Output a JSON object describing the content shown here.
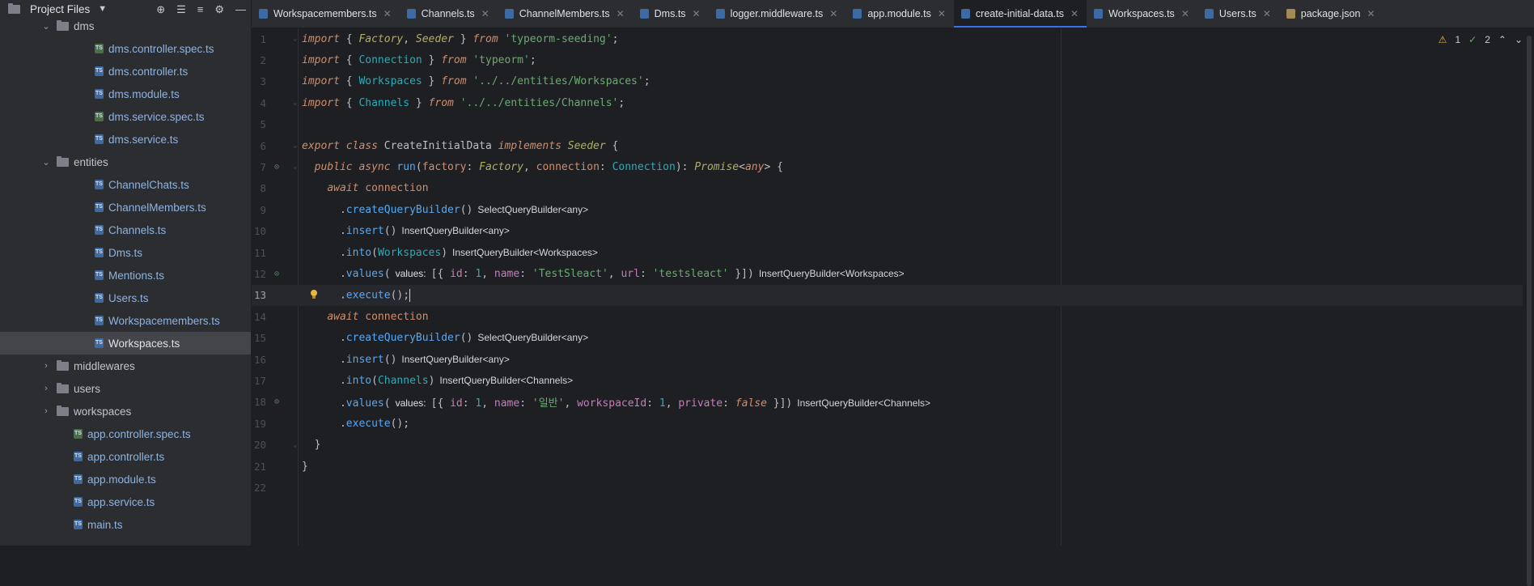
{
  "project": {
    "title": "Project Files",
    "tree": [
      {
        "label": "dms",
        "kind": "folder",
        "depth": 1,
        "expanded": true
      },
      {
        "label": "dms.controller.spec.ts",
        "kind": "file",
        "depth": 2,
        "spec": true
      },
      {
        "label": "dms.controller.ts",
        "kind": "file",
        "depth": 2
      },
      {
        "label": "dms.module.ts",
        "kind": "file",
        "depth": 2
      },
      {
        "label": "dms.service.spec.ts",
        "kind": "file",
        "depth": 2,
        "spec": true
      },
      {
        "label": "dms.service.ts",
        "kind": "file",
        "depth": 2
      },
      {
        "label": "entities",
        "kind": "folder",
        "depth": 1,
        "expanded": true
      },
      {
        "label": "ChannelChats.ts",
        "kind": "file",
        "depth": 2
      },
      {
        "label": "ChannelMembers.ts",
        "kind": "file",
        "depth": 2
      },
      {
        "label": "Channels.ts",
        "kind": "file",
        "depth": 2
      },
      {
        "label": "Dms.ts",
        "kind": "file",
        "depth": 2
      },
      {
        "label": "Mentions.ts",
        "kind": "file",
        "depth": 2
      },
      {
        "label": "Users.ts",
        "kind": "file",
        "depth": 2
      },
      {
        "label": "Workspacemembers.ts",
        "kind": "file",
        "depth": 2
      },
      {
        "label": "Workspaces.ts",
        "kind": "file",
        "depth": 2,
        "selected": true
      },
      {
        "label": "middlewares",
        "kind": "folder",
        "depth": 1,
        "expanded": false
      },
      {
        "label": "users",
        "kind": "folder",
        "depth": 1,
        "expanded": false
      },
      {
        "label": "workspaces",
        "kind": "folder",
        "depth": 1,
        "expanded": false
      },
      {
        "label": "app.controller.spec.ts",
        "kind": "file",
        "depth": 1,
        "spec": true
      },
      {
        "label": "app.controller.ts",
        "kind": "file",
        "depth": 1
      },
      {
        "label": "app.module.ts",
        "kind": "file",
        "depth": 1
      },
      {
        "label": "app.service.ts",
        "kind": "file",
        "depth": 1
      },
      {
        "label": "main.ts",
        "kind": "file",
        "depth": 1
      }
    ]
  },
  "tabs": [
    {
      "label": "Workspacemembers.ts"
    },
    {
      "label": "Channels.ts"
    },
    {
      "label": "ChannelMembers.ts"
    },
    {
      "label": "Dms.ts"
    },
    {
      "label": "logger.middleware.ts"
    },
    {
      "label": "app.module.ts"
    },
    {
      "label": "create-initial-data.ts",
      "active": true
    },
    {
      "label": "Workspaces.ts"
    },
    {
      "label": "Users.ts"
    },
    {
      "label": "package.json",
      "json": true
    }
  ],
  "inspections": {
    "warnings": "1",
    "weak_warnings": "2"
  },
  "editor": {
    "current_line": 13,
    "lines": [
      {
        "n": "1",
        "fold": true,
        "html": "<span class=\"kw\">import</span> { <span class=\"itype\">Factory</span>, <span class=\"itype\">Seeder</span> } <span class=\"kw\">from</span> <span class=\"str\">'typeorm-seeding'</span>;"
      },
      {
        "n": "2",
        "html": "<span class=\"kw\">import</span> { <span class=\"type\">Connection</span> } <span class=\"kw\">from</span> <span class=\"str\">'typeorm'</span>;"
      },
      {
        "n": "3",
        "html": "<span class=\"kw\">import</span> { <span class=\"type\">Workspaces</span> } <span class=\"kw\">from</span> <span class=\"str\">'../../entities/Workspaces'</span>;"
      },
      {
        "n": "4",
        "fold": true,
        "html": "<span class=\"kw\">import</span> { <span class=\"type\">Channels</span> } <span class=\"kw\">from</span> <span class=\"str\">'../../entities/Channels'</span>;"
      },
      {
        "n": "5",
        "html": ""
      },
      {
        "n": "6",
        "fold": true,
        "html": "<span class=\"kw\">export class</span> <span class=\"cls\">CreateInitialData</span> <span class=\"kw\">implements</span> <span class=\"itype\">Seeder</span> {"
      },
      {
        "n": "7",
        "mark": true,
        "fold": true,
        "html": "  <span class=\"kw\">public async</span> <span class=\"fn\">run</span>(<span class=\"kw2\">factory</span>: <span class=\"itype\">Factory</span>, <span class=\"kw2\">connection</span>: <span class=\"type\">Connection</span>): <span class=\"itype\">Promise</span>&lt;<span class=\"kw\">any</span>&gt; {"
      },
      {
        "n": "8",
        "html": "    <span class=\"kw\">await</span> <span class=\"kw2\">connection</span>"
      },
      {
        "n": "9",
        "html": "      .<span class=\"fn\">createQueryBuilder</span>()<span class=\"hint\">SelectQueryBuilder&lt;any&gt;</span>"
      },
      {
        "n": "10",
        "html": "      .<span class=\"fn\">insert</span>()<span class=\"hint\">InsertQueryBuilder&lt;any&gt;</span>"
      },
      {
        "n": "11",
        "html": "      .<span class=\"fn\">into</span>(<span class=\"type\">Workspaces</span>)<span class=\"hint\">InsertQueryBuilder&lt;Workspaces&gt;</span>"
      },
      {
        "n": "12",
        "mark": true,
        "html": "      .<span class=\"fn\">values</span>(<span class=\"hint lbl\">values:</span>[{ <span class=\"prop\">id</span>: <span class=\"num\">1</span>, <span class=\"prop\">name</span>: <span class=\"str\">'TestSleact'</span>, <span class=\"prop\">url</span>: <span class=\"str\">'testsleact'</span> }])<span class=\"hint\">InsertQueryBuilder&lt;Workspaces&gt;</span>"
      },
      {
        "n": "13",
        "bulb": true,
        "html": "      .<span class=\"fn\">execute</span>();<span class=\"cursor\"></span>"
      },
      {
        "n": "14",
        "html": "    <span class=\"kw\">await</span> <span class=\"kw2\">connection</span>"
      },
      {
        "n": "15",
        "html": "      .<span class=\"fn\">createQueryBuilder</span>()<span class=\"hint\">SelectQueryBuilder&lt;any&gt;</span>"
      },
      {
        "n": "16",
        "html": "      .<span class=\"fn\">insert</span>()<span class=\"hint\">InsertQueryBuilder&lt;any&gt;</span>"
      },
      {
        "n": "17",
        "html": "      .<span class=\"fn\">into</span>(<span class=\"type\">Channels</span>)<span class=\"hint\">InsertQueryBuilder&lt;Channels&gt;</span>"
      },
      {
        "n": "18",
        "mark": true,
        "html": "      .<span class=\"fn\">values</span>(<span class=\"hint lbl\">values:</span>[{ <span class=\"prop\">id</span>: <span class=\"num\">1</span>, <span class=\"prop\">name</span>: <span class=\"str\">'일반'</span>, <span class=\"prop\">workspaceId</span>: <span class=\"num\">1</span>, <span class=\"prop\">private</span>: <span class=\"kw\">false</span> }])<span class=\"hint\">InsertQueryBuilder&lt;Channels&gt;</span>"
      },
      {
        "n": "19",
        "html": "      .<span class=\"fn\">execute</span>();"
      },
      {
        "n": "20",
        "fold": true,
        "html": "  }"
      },
      {
        "n": "21",
        "html": "}"
      },
      {
        "n": "22",
        "html": ""
      }
    ]
  }
}
